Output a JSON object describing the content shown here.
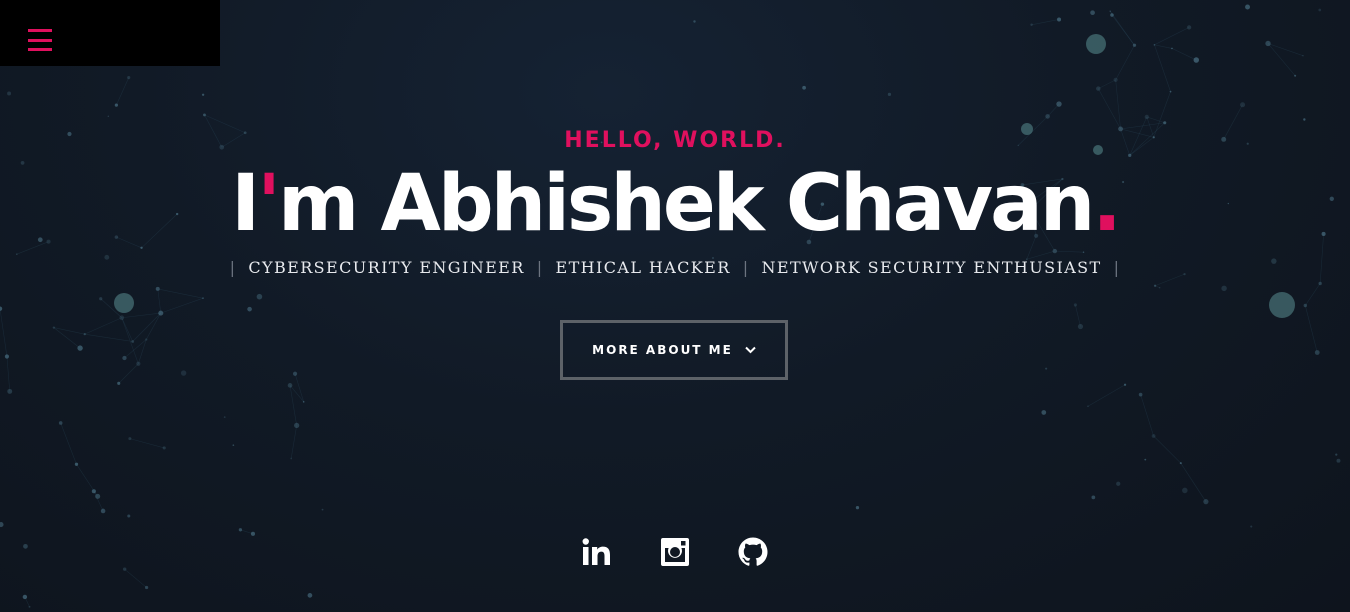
{
  "header": {
    "menu_icon": "hamburger-menu-icon",
    "accent_color": "#e0105e"
  },
  "hero": {
    "greeting": "HELLO, WORLD.",
    "name_prefix": "I",
    "name_apostrophe": "'",
    "name_rest": "m Abhishek Chavan",
    "name_period": ".",
    "separator": "|",
    "roles": [
      "CYBERSECURITY ENGINEER",
      "ETHICAL HACKER",
      "NETWORK SECURITY ENTHUSIAST"
    ],
    "cta_label": "MORE ABOUT ME",
    "cta_icon": "chevron-down-icon"
  },
  "social": {
    "icons": [
      "linkedin-icon",
      "instagram-icon",
      "github-icon"
    ]
  }
}
